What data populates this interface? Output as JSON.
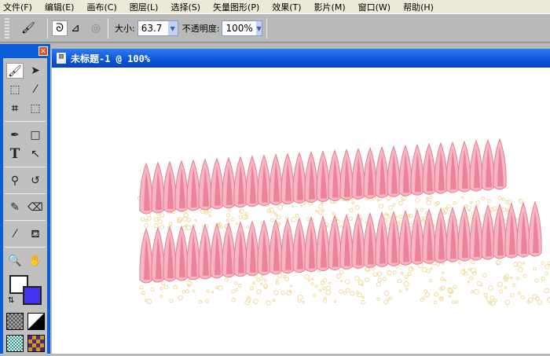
{
  "menubar": [
    "文件(F)",
    "编辑(E)",
    "画布(C)",
    "图层(L)",
    "选择(S)",
    "矢量图形(P)",
    "效果(T)",
    "影片(M)",
    "窗口(W)",
    "帮助(H)"
  ],
  "toolbar": {
    "size_label": "大小:",
    "size_value": "63.7",
    "opacity_label": "不透明度:",
    "opacity_value": "100%"
  },
  "tools": {
    "text_tool": "T"
  },
  "document": {
    "title": "未标题-1 @ 100%"
  },
  "colors": {
    "stroke": "#ffffff",
    "fill": "#4433ee",
    "petal": "#f08aa0",
    "dots": "#f0dca0",
    "title_blue": "#0a55d8"
  }
}
